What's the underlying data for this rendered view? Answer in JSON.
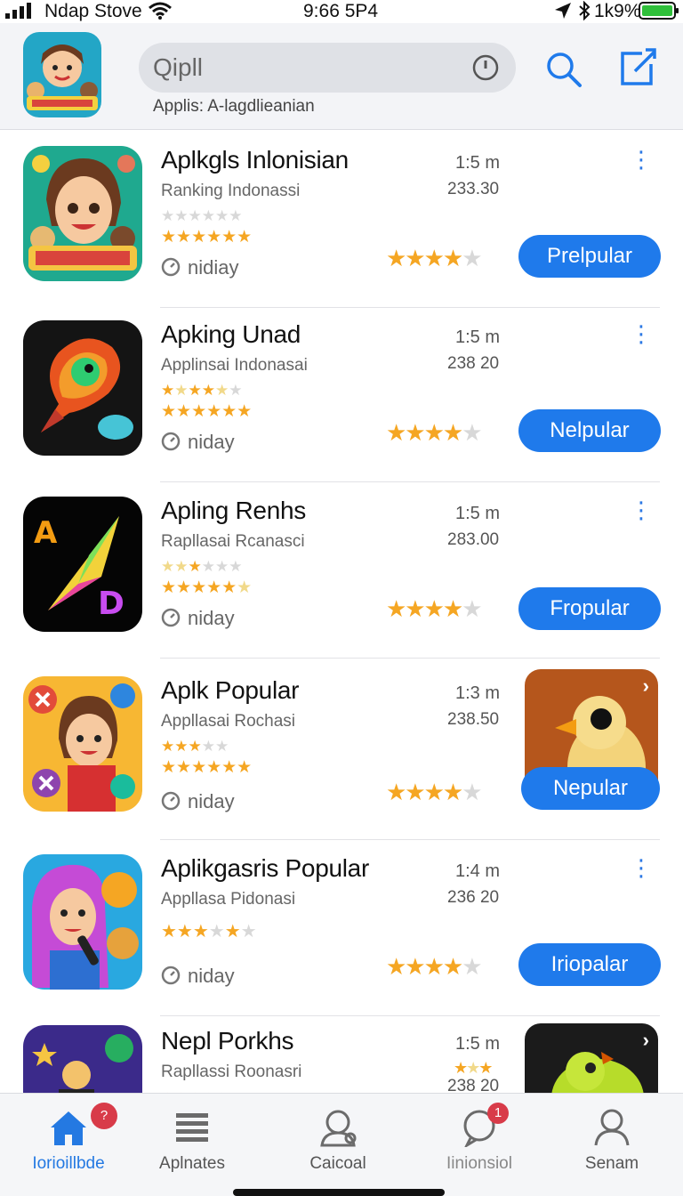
{
  "status_bar": {
    "carrier": "Ndap Stove",
    "time": "9:66 5P4",
    "battery_pct": "1k9%",
    "icons": [
      "signal-icon",
      "wifi-icon",
      "location-icon",
      "bluetooth-icon",
      "battery-icon"
    ]
  },
  "header": {
    "search_value": "Qipll",
    "subtitle": "Applis: A-lagdlieanian",
    "icons": [
      "app-logo",
      "mic-icon",
      "search-icon",
      "compose-icon"
    ],
    "accent_color": "#1f7aeb"
  },
  "apps": [
    {
      "name": "Aplkgls Inlonisian",
      "subtitle": "Ranking  Indonassi",
      "time": "nidiay",
      "size": "1:5 m",
      "downloads": "233.30",
      "small_stars": 0,
      "main_stars": 6,
      "rating": 3.5,
      "button": "Prelpular",
      "has_preview": false
    },
    {
      "name": "Apking Unad",
      "subtitle": "Applinsai Indonasai",
      "time": "niday",
      "size": "1:5 m",
      "downloads": "238 20",
      "small_stars": 3.5,
      "main_stars": 6,
      "rating": 3.5,
      "button": "Nelpular",
      "has_preview": false
    },
    {
      "name": "Apling Renhs",
      "subtitle": "Rapllasai Rcanasci",
      "time": "niday",
      "size": "1:5 m",
      "downloads": "283.00",
      "small_stars": 3,
      "main_stars": 5.5,
      "rating": 3.5,
      "button": "Fropular",
      "has_preview": false
    },
    {
      "name": "Aplk Popular",
      "subtitle": "Appllasai Rochasi",
      "time": "niday",
      "size": "1:3 m",
      "downloads": "238.50",
      "small_stars": 3,
      "main_stars": 6,
      "rating": 3.5,
      "button": "Nepular",
      "has_preview": true
    },
    {
      "name": "Aplikgasris Popular",
      "subtitle": "Appllasa Pidonasi",
      "time": "niday",
      "size": "1:4 m",
      "downloads": "236 20",
      "small_stars": 4,
      "main_stars": 0,
      "rating": 3.5,
      "button": "Iriopalar",
      "has_preview": false
    },
    {
      "name": "Nepl  Porkhs",
      "subtitle": "Rapllassi Roonasri",
      "time": "",
      "size": "1:5 m",
      "downloads": "238 20",
      "small_stars": 3,
      "main_stars": 0,
      "rating": 0,
      "button": "",
      "has_preview": true
    }
  ],
  "tabs": [
    {
      "label": "Iorioillbde",
      "icon": "home-icon",
      "badge": "?",
      "active": true
    },
    {
      "label": "Aplnates",
      "icon": "list-icon",
      "badge": "",
      "active": false
    },
    {
      "label": "Caicoal",
      "icon": "person-search-icon",
      "badge": "",
      "active": false
    },
    {
      "label": "Iinionsiol",
      "icon": "chat-icon",
      "badge": "1",
      "active": false
    },
    {
      "label": "Senam",
      "icon": "profile-icon",
      "badge": "",
      "active": false
    }
  ]
}
